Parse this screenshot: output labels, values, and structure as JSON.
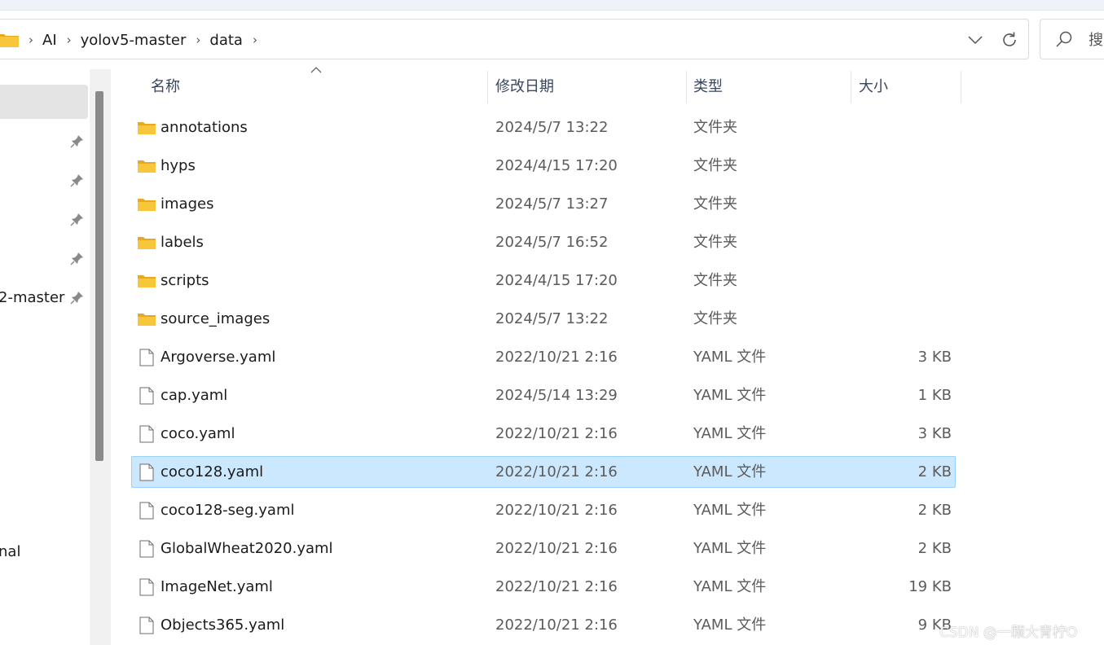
{
  "breadcrumb": [
    "AI",
    "yolov5-master",
    "data"
  ],
  "search": {
    "placeholder": "搜"
  },
  "columns": {
    "name": "名称",
    "date": "修改日期",
    "type": "类型",
    "size": "大小"
  },
  "sidebar": {
    "items": [
      {
        "label": "2-master"
      },
      {
        "label": "nal"
      }
    ]
  },
  "files": [
    {
      "name": "annotations",
      "date": "2024/5/7 13:22",
      "type": "文件夹",
      "size": "",
      "kind": "folder"
    },
    {
      "name": "hyps",
      "date": "2024/4/15 17:20",
      "type": "文件夹",
      "size": "",
      "kind": "folder"
    },
    {
      "name": "images",
      "date": "2024/5/7 13:27",
      "type": "文件夹",
      "size": "",
      "kind": "folder"
    },
    {
      "name": "labels",
      "date": "2024/5/7 16:52",
      "type": "文件夹",
      "size": "",
      "kind": "folder"
    },
    {
      "name": "scripts",
      "date": "2024/4/15 17:20",
      "type": "文件夹",
      "size": "",
      "kind": "folder"
    },
    {
      "name": "source_images",
      "date": "2024/5/7 13:22",
      "type": "文件夹",
      "size": "",
      "kind": "folder"
    },
    {
      "name": "Argoverse.yaml",
      "date": "2022/10/21 2:16",
      "type": "YAML 文件",
      "size": "3 KB",
      "kind": "file"
    },
    {
      "name": "cap.yaml",
      "date": "2024/5/14 13:29",
      "type": "YAML 文件",
      "size": "1 KB",
      "kind": "file"
    },
    {
      "name": "coco.yaml",
      "date": "2022/10/21 2:16",
      "type": "YAML 文件",
      "size": "3 KB",
      "kind": "file"
    },
    {
      "name": "coco128.yaml",
      "date": "2022/10/21 2:16",
      "type": "YAML 文件",
      "size": "2 KB",
      "kind": "file",
      "selected": true
    },
    {
      "name": "coco128-seg.yaml",
      "date": "2022/10/21 2:16",
      "type": "YAML 文件",
      "size": "2 KB",
      "kind": "file"
    },
    {
      "name": "GlobalWheat2020.yaml",
      "date": "2022/10/21 2:16",
      "type": "YAML 文件",
      "size": "2 KB",
      "kind": "file"
    },
    {
      "name": "ImageNet.yaml",
      "date": "2022/10/21 2:16",
      "type": "YAML 文件",
      "size": "19 KB",
      "kind": "file"
    },
    {
      "name": "Objects365.yaml",
      "date": "2022/10/21 2:16",
      "type": "YAML 文件",
      "size": "9 KB",
      "kind": "file"
    }
  ],
  "watermark": "CSDN @一颗大青柠O",
  "colors": {
    "selection_bg": "#cce8ff",
    "selection_border": "#99d1ff",
    "folder": "#f8c63a",
    "header_text": "#38465e"
  }
}
